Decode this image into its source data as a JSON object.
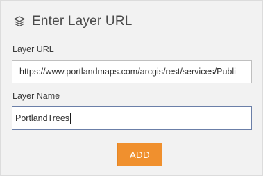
{
  "dialog": {
    "title": "Enter Layer URL",
    "title_icon": "layers-icon"
  },
  "form": {
    "url_label": "Layer URL",
    "url_value": "https://www.portlandmaps.com/arcgis/rest/services/Publi",
    "name_label": "Layer Name",
    "name_value": "PortlandTrees"
  },
  "actions": {
    "add_label": "ADD"
  },
  "colors": {
    "panel_background": "#f2f2f2",
    "add_button": "#f0902e",
    "focused_border": "#6b7fa8"
  }
}
